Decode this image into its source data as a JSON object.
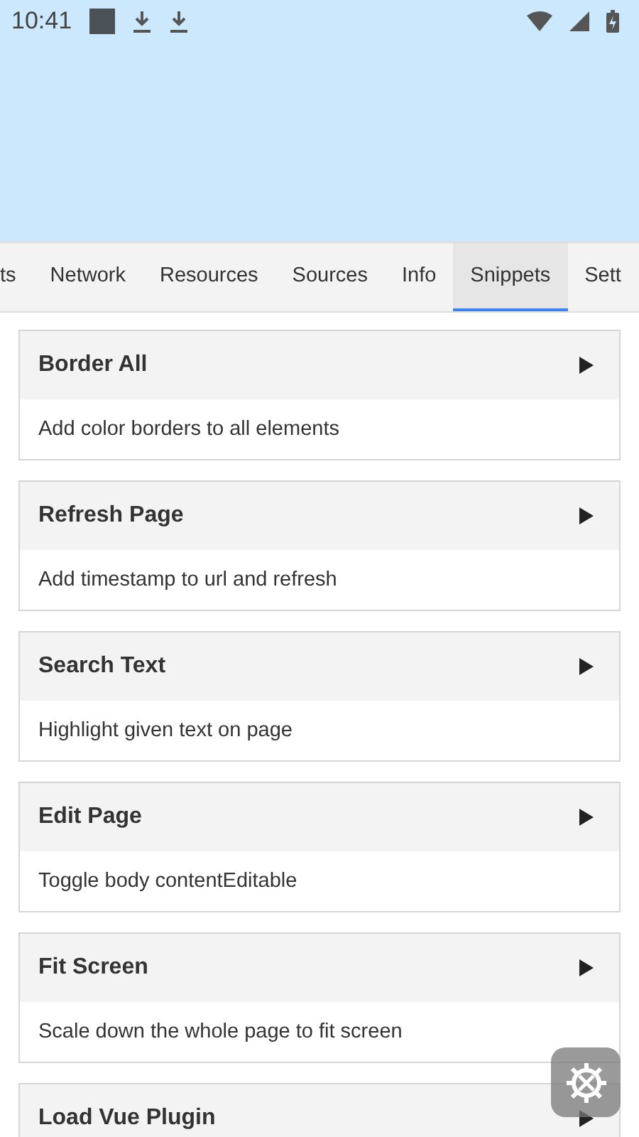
{
  "status_bar": {
    "time": "10:41"
  },
  "tabs": [
    {
      "label": "ts",
      "selected": false
    },
    {
      "label": "Network",
      "selected": false
    },
    {
      "label": "Resources",
      "selected": false
    },
    {
      "label": "Sources",
      "selected": false
    },
    {
      "label": "Info",
      "selected": false
    },
    {
      "label": "Snippets",
      "selected": true
    },
    {
      "label": "Sett",
      "selected": false
    }
  ],
  "snippets": [
    {
      "title": "Border All",
      "description": "Add color borders to all elements"
    },
    {
      "title": "Refresh Page",
      "description": "Add timestamp to url and refresh"
    },
    {
      "title": "Search Text",
      "description": "Highlight given text on page"
    },
    {
      "title": "Edit Page",
      "description": "Toggle body contentEditable"
    },
    {
      "title": "Fit Screen",
      "description": "Scale down the whole page to fit screen"
    },
    {
      "title": "Load Vue Plugin"
    }
  ]
}
